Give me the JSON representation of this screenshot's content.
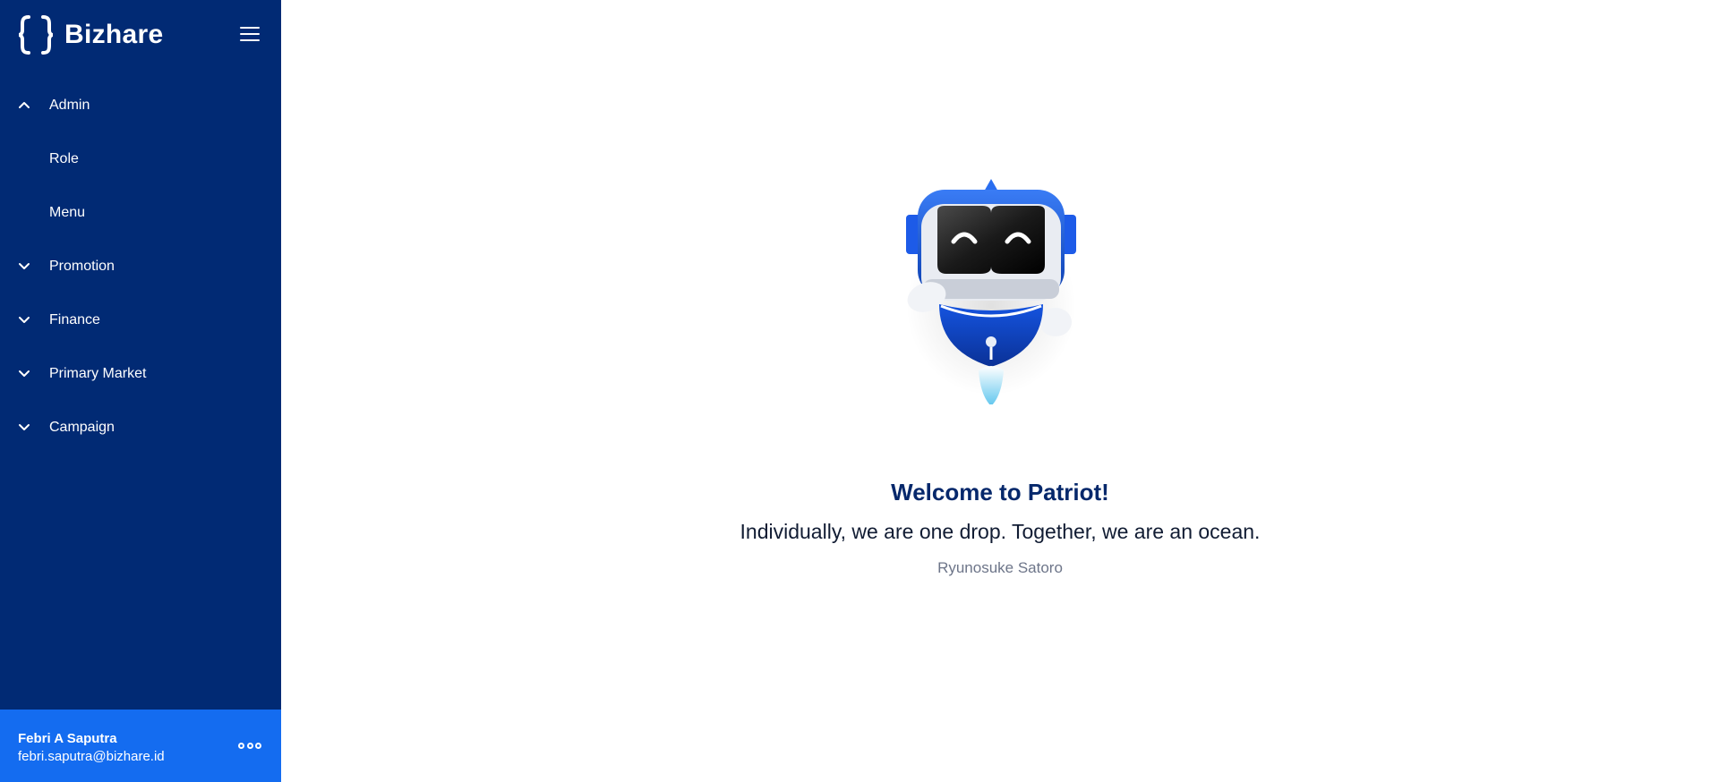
{
  "brand": {
    "name": "Bizhare",
    "logo_icon": "braces-logo-icon"
  },
  "colors": {
    "sidebar": "#012a74",
    "user_panel": "#146cf0",
    "heading": "#06286b"
  },
  "sidebar": {
    "menu_icon": "hamburger-icon",
    "items": [
      {
        "label": "Admin",
        "icon": "chevron-up-icon",
        "expanded": true
      },
      {
        "label": "Role"
      },
      {
        "label": "Menu"
      },
      {
        "label": "Promotion",
        "icon": "chevron-down-icon"
      },
      {
        "label": "Finance",
        "icon": "chevron-down-icon"
      },
      {
        "label": "Primary Market",
        "icon": "chevron-down-icon"
      },
      {
        "label": "Campaign",
        "icon": "chevron-down-icon"
      }
    ]
  },
  "user": {
    "name": "Febri A Saputra",
    "email": "febri.saputra@bizhare.id",
    "more_icon": "more-options-icon"
  },
  "main": {
    "mascot_icon": "robot-mascot-icon",
    "welcome": "Welcome to Patriot!",
    "quote": "Individually, we are one drop. Together, we are an ocean.",
    "author": "Ryunosuke Satoro"
  }
}
